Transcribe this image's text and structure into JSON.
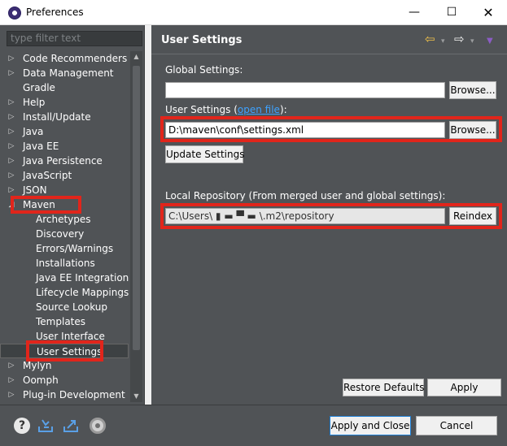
{
  "window": {
    "title": "Preferences",
    "minimize": "—",
    "maximize": "☐",
    "close": "✕"
  },
  "sidebar": {
    "filter_placeholder": "type filter text",
    "items": [
      {
        "label": "Code Recommenders",
        "level": 0,
        "expander": "collapsed"
      },
      {
        "label": "Data Management",
        "level": 0,
        "expander": "collapsed"
      },
      {
        "label": "Gradle",
        "level": 0,
        "expander": "none"
      },
      {
        "label": "Help",
        "level": 0,
        "expander": "collapsed"
      },
      {
        "label": "Install/Update",
        "level": 0,
        "expander": "collapsed"
      },
      {
        "label": "Java",
        "level": 0,
        "expander": "collapsed"
      },
      {
        "label": "Java EE",
        "level": 0,
        "expander": "collapsed"
      },
      {
        "label": "Java Persistence",
        "level": 0,
        "expander": "collapsed"
      },
      {
        "label": "JavaScript",
        "level": 0,
        "expander": "collapsed"
      },
      {
        "label": "JSON",
        "level": 0,
        "expander": "collapsed"
      },
      {
        "label": "Maven",
        "level": 0,
        "expander": "expanded"
      },
      {
        "label": "Archetypes",
        "level": 1,
        "expander": "none"
      },
      {
        "label": "Discovery",
        "level": 1,
        "expander": "none"
      },
      {
        "label": "Errors/Warnings",
        "level": 1,
        "expander": "none"
      },
      {
        "label": "Installations",
        "level": 1,
        "expander": "none"
      },
      {
        "label": "Java EE Integration",
        "level": 1,
        "expander": "none"
      },
      {
        "label": "Lifecycle Mappings",
        "level": 1,
        "expander": "none"
      },
      {
        "label": "Source Lookup",
        "level": 1,
        "expander": "none"
      },
      {
        "label": "Templates",
        "level": 1,
        "expander": "none"
      },
      {
        "label": "User Interface",
        "level": 1,
        "expander": "none"
      },
      {
        "label": "User Settings",
        "level": 1,
        "expander": "none",
        "selected": true
      },
      {
        "label": "Mylyn",
        "level": 0,
        "expander": "collapsed"
      },
      {
        "label": "Oomph",
        "level": 0,
        "expander": "collapsed"
      },
      {
        "label": "Plug-in Development",
        "level": 0,
        "expander": "collapsed"
      }
    ]
  },
  "main": {
    "title": "User Settings",
    "global_settings_label": "Global Settings:",
    "global_settings_value": "",
    "user_settings_prefix": "User Settings (",
    "open_file_link": "open file",
    "user_settings_suffix": "):",
    "user_settings_value": "D:\\maven\\conf\\settings.xml",
    "browse_label": "Browse...",
    "update_settings_label": "Update Settings",
    "local_repo_label": "Local Repository (From merged user and global settings):",
    "local_repo_value": "C:\\Users\\ ▮ ▬ ▀ ▬ \\.m2\\repository",
    "reindex_label": "Reindex",
    "restore_defaults_label": "Restore Defaults",
    "apply_label": "Apply"
  },
  "footer": {
    "help_glyph": "?",
    "apply_close_label": "Apply and Close",
    "cancel_label": "Cancel"
  },
  "colors": {
    "panel_bg": "#505356",
    "highlight": "#e1251b",
    "link": "#3ea2ff"
  }
}
